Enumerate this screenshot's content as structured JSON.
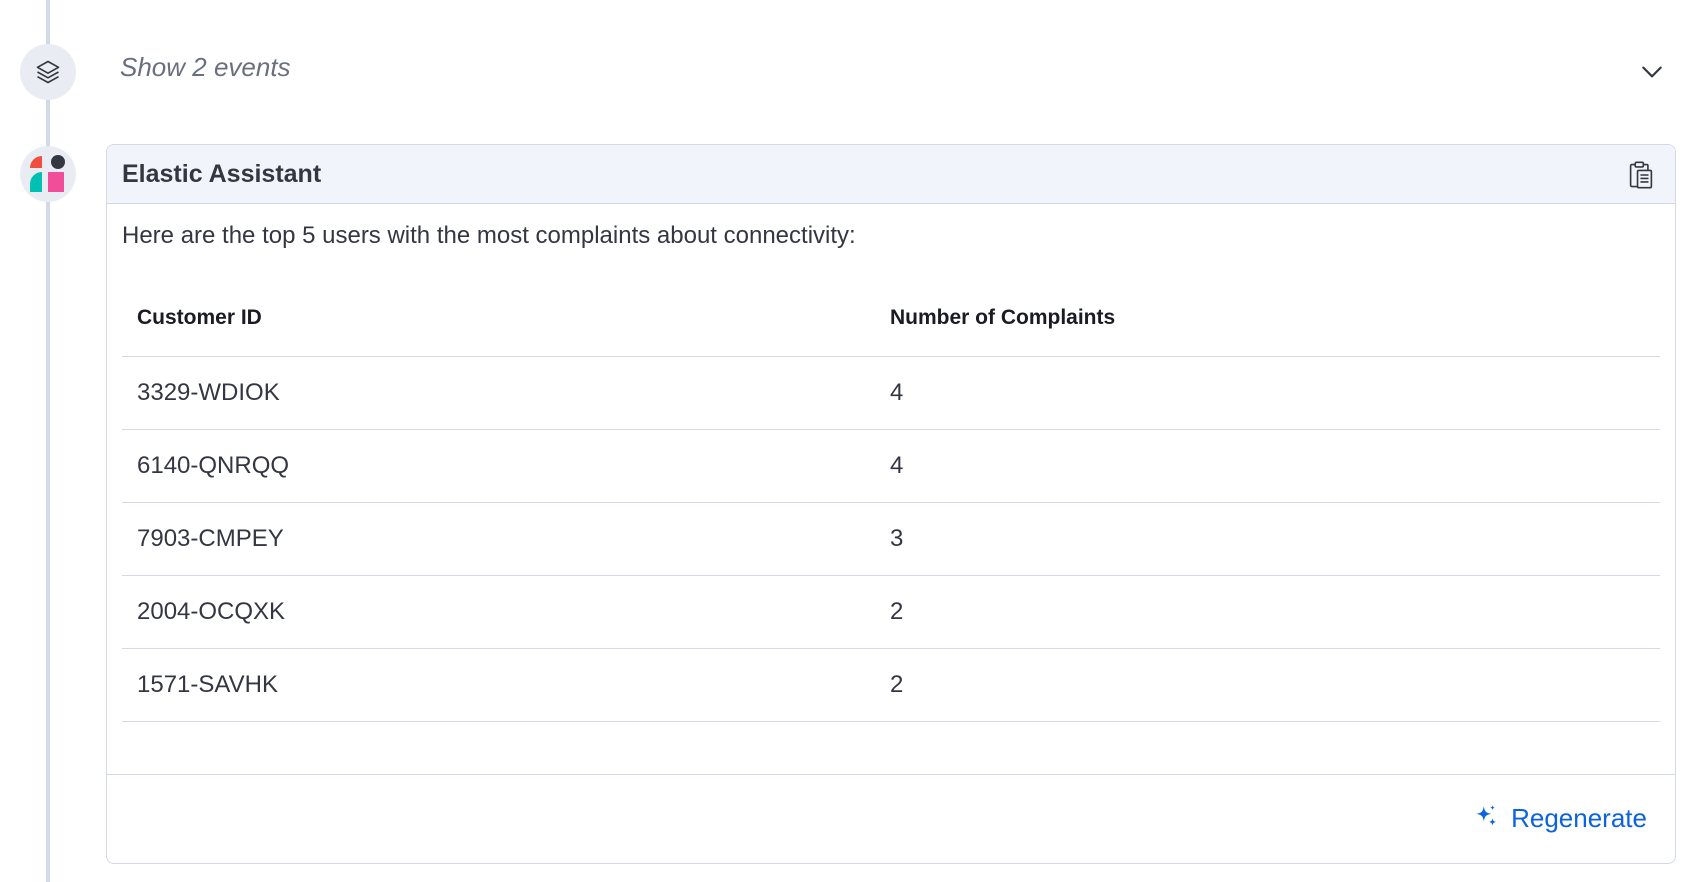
{
  "events": {
    "toggle_label": "Show 2 events"
  },
  "assistant": {
    "title": "Elastic Assistant",
    "intro": "Here are the top 5 users with the most complaints about connectivity:",
    "table": {
      "headers": [
        "Customer ID",
        "Number of Complaints"
      ],
      "rows": [
        [
          "3329-WDIOK",
          "4"
        ],
        [
          "6140-QNRQQ",
          "4"
        ],
        [
          "7903-CMPEY",
          "3"
        ],
        [
          "2004-OCQXK",
          "2"
        ],
        [
          "1571-SAVHK",
          "2"
        ]
      ]
    },
    "regenerate_label": "Regenerate"
  },
  "colors": {
    "accent": "#0b64dd",
    "header_bg": "#f1f4fa",
    "border": "#d3dae6"
  },
  "icons": {
    "events": "layers-icon",
    "toggle": "chevron-down-icon",
    "copy": "clipboard-icon",
    "regenerate": "sparkles-icon",
    "avatar": "elastic-logo-icon"
  }
}
